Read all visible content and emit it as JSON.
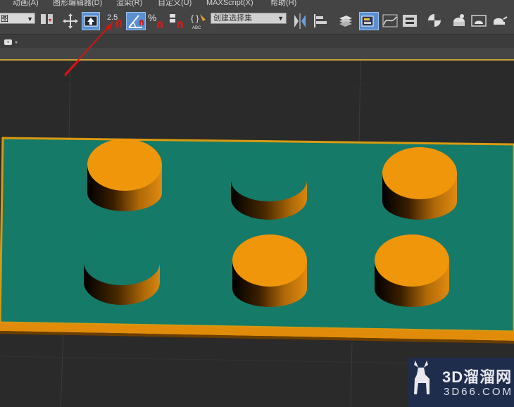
{
  "menubar": {
    "items": [
      "动画(A)",
      "图形编辑器(D)",
      "渲染(R)",
      "自定义(U)",
      "MAXScript(X)",
      "帮助(H)"
    ]
  },
  "toolbar": {
    "view_dropdown_value": "图",
    "snap_angle_label": "2.5",
    "percent_snap_label": "%",
    "named_selection_set_placeholder": "创建选择集",
    "edit_named_label": "{ }",
    "abc_label": "ABC"
  },
  "colors": {
    "accent_active": "#5a8fd0",
    "plane_color": "#147c6a",
    "cylinder_color": "#f0960a",
    "viewport_border": "#c9a43a",
    "annotation_arrow": "#d21414"
  },
  "icons": [
    "select-region-icon",
    "move-icon",
    "select-object-icon",
    "snap-toggle-icon",
    "angle-snap-icon",
    "percent-snap-icon",
    "spinner-snap-icon",
    "edit-named-selection-icon",
    "mirror-icon",
    "align-icon",
    "layer-manager-icon",
    "scene-explorer-icon",
    "curve-editor-icon",
    "schematic-view-icon",
    "material-editor-icon",
    "render-setup-icon",
    "rendered-frame-icon",
    "render-icon"
  ],
  "watermark": {
    "title": "3D溜溜网",
    "subtitle": "3D66.COM"
  }
}
